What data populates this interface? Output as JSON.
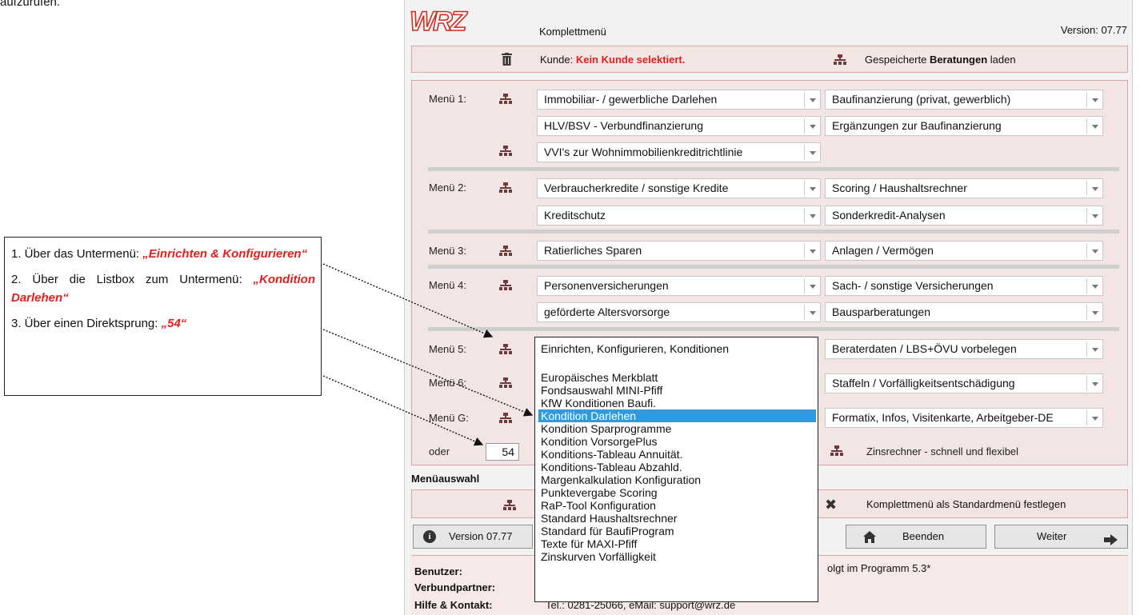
{
  "document": {
    "intro_fragment": "aufzurufen."
  },
  "callout": {
    "step1_prefix": "1. Über das Untermenü: ",
    "step1_em": "„Einrichten & Konfigurieren“",
    "step2_prefix": "2. Über die Listbox zum Untermenü: ",
    "step2_em": "„Kondition Darlehen“",
    "step3_prefix": "3. Über einen Direktsprung: ",
    "step3_em": "„54“"
  },
  "app": {
    "logo": "WRZ",
    "title": "Komplettmenü",
    "version": "Version: 07.77",
    "kunde_prefix": "Kunde: ",
    "kunde_value": "Kein Kunde selektiert.",
    "beratungen_prefix": "Gespeicherte ",
    "beratungen_bold": "Beratungen",
    "beratungen_suffix": " laden"
  },
  "menus": {
    "m1": {
      "label": "Menü 1:",
      "a": "Immobiliar- / gewerbliche Darlehen",
      "b": "Baufinanzierung (privat, gewerblich)",
      "c": "HLV/BSV - Verbundfinanzierung",
      "d": "Ergänzungen zur Baufinanzierung",
      "e": "VVI's zur Wohnimmobilienkreditrichtlinie"
    },
    "m2": {
      "label": "Menü 2:",
      "a": "Verbraucherkredite / sonstige Kredite",
      "b": "Scoring / Haushaltsrechner",
      "c": "Kreditschutz",
      "d": "Sonderkredit-Analysen"
    },
    "m3": {
      "label": "Menü 3:",
      "a": "Ratierliches Sparen",
      "b": "Anlagen / Vermögen"
    },
    "m4": {
      "label": "Menü 4:",
      "a": "Personenversicherungen",
      "b": "Sach- / sonstige Versicherungen",
      "c": "geförderte Altersvorsorge",
      "d": "Bausparberatungen"
    },
    "m5": {
      "label": "Menü 5:",
      "a": "Einrichten, Konfigurieren, Konditionen",
      "b": "Beraterdaten / LBS+ÖVU vorbelegen"
    },
    "m6": {
      "label": "Menü 6:",
      "b": "Staffeln / Vorfälligkeitsentschädigung"
    },
    "mg": {
      "label": "Menü G:",
      "b": "Formatix, Infos, Visitenkarte, Arbeitgeber-DE"
    },
    "oder": {
      "label": "oder",
      "value": "54",
      "zins": "Zinsrechner - schnell und flexibel"
    }
  },
  "listbox": {
    "items": [
      "Europäisches Merkblatt",
      "Fondsauswahl MINI-Pfiff",
      "KfW Konditionen Baufi.",
      "Kondition Darlehen",
      "Kondition Sparprogramme",
      "Kondition VorsorgePlus",
      "Konditions-Tableau Annuität.",
      "Konditions-Tableau Abzahld.",
      "Margenkalkulation Konfiguration",
      "Punktevergabe Scoring",
      "RaP-Tool Konfiguration",
      "Standard Haushaltsrechner",
      "Standard für BaufiProgram",
      "Texte für MAXI-Pfiff",
      "Zinskurven Vorfälligkeit"
    ],
    "selected": "Kondition Darlehen"
  },
  "footer": {
    "menuauswahl": "Menüauswahl",
    "standard": "Komplettmenü als Standardmenü festlegen",
    "btn_version": "Version 07.77",
    "btn_beenden": "Beenden",
    "btn_weiter": "Weiter",
    "benutzer": "Benutzer:",
    "benutzer_note": "olgt im Programm 5.3*",
    "verbundpartner": "Verbundpartner:",
    "hilfe": "Hilfe & Kontakt:",
    "hilfe_value": "Tel.: 0281-25066, eMail: support@wrz.de"
  },
  "colors": {
    "accent": "#e2211c",
    "panel": "#f4e5e5",
    "selection": "#3399dd"
  }
}
